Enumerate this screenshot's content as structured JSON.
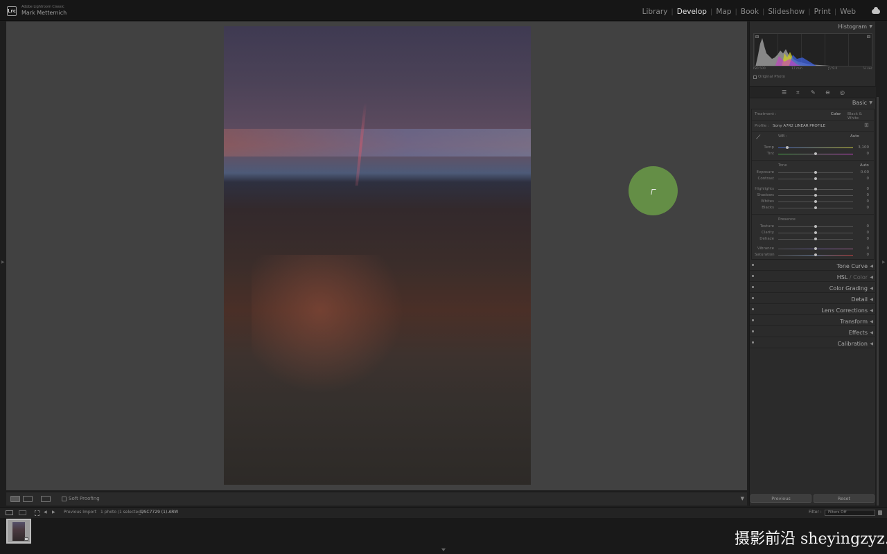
{
  "app": {
    "badge": "Lrc",
    "name": "Adobe Lightroom Classic",
    "user": "Mark Metternich"
  },
  "modules": [
    {
      "label": "Library",
      "active": false
    },
    {
      "label": "Develop",
      "active": true
    },
    {
      "label": "Map",
      "active": false
    },
    {
      "label": "Book",
      "active": false
    },
    {
      "label": "Slideshow",
      "active": false
    },
    {
      "label": "Print",
      "active": false
    },
    {
      "label": "Web",
      "active": false
    }
  ],
  "toolbar": {
    "soft_proofing": "Soft Proofing"
  },
  "histogram": {
    "title": "Histogram",
    "iso": "ISO 500",
    "focal": "17 mm",
    "aperture": "ƒ / 9.0",
    "shutter": "⅓ sec",
    "original_photo": "Original Photo"
  },
  "basic": {
    "title": "Basic",
    "treatment_label": "Treatment :",
    "treatment_color": "Color",
    "treatment_bw": "Black & White",
    "profile_label": "Profile :",
    "profile_value": "Sony A7R2 LINEAR PROFILE",
    "wb_label": "WB :",
    "wb_value": "Auto",
    "tone_label": "Tone",
    "tone_auto": "Auto",
    "presence_label": "Presence",
    "temp": {
      "label": "Temp",
      "value": "3,100",
      "pos": 0.12
    },
    "tint": {
      "label": "Tint",
      "value": "0",
      "pos": 0.5
    },
    "exposure": {
      "label": "Exposure",
      "value": "0.00",
      "pos": 0.5
    },
    "contrast": {
      "label": "Contrast",
      "value": "0",
      "pos": 0.5
    },
    "highlights": {
      "label": "Highlights",
      "value": "0",
      "pos": 0.5
    },
    "shadows": {
      "label": "Shadows",
      "value": "0",
      "pos": 0.5
    },
    "whites": {
      "label": "Whites",
      "value": "0",
      "pos": 0.5
    },
    "blacks": {
      "label": "Blacks",
      "value": "0",
      "pos": 0.5
    },
    "texture": {
      "label": "Texture",
      "value": "0",
      "pos": 0.5
    },
    "clarity": {
      "label": "Clarity",
      "value": "0",
      "pos": 0.5
    },
    "dehaze": {
      "label": "Dehaze",
      "value": "0",
      "pos": 0.5
    },
    "vibrance": {
      "label": "Vibrance",
      "value": "0",
      "pos": 0.5
    },
    "saturation": {
      "label": "Saturation",
      "value": "0",
      "pos": 0.5
    }
  },
  "panels": {
    "tone_curve": "Tone Curve",
    "hsl_a": "HSL",
    "hsl_sep": " / ",
    "hsl_b": "Color",
    "color_grading": "Color Grading",
    "detail": "Detail",
    "lens_corrections": "Lens Corrections",
    "transform": "Transform",
    "effects": "Effects",
    "calibration": "Calibration"
  },
  "buttons": {
    "previous": "Previous",
    "reset": "Reset"
  },
  "filmstrip": {
    "source": "Previous Import",
    "count": "1 photo /1 selected /",
    "filename": "_DSC7729 (1).ARW",
    "filter_label": "Filter :",
    "filter_value": "Filters Off"
  },
  "watermark": "摄影前沿 sheyingzyz.com",
  "colors": {
    "accent_halo": "#70a848",
    "panel_bg": "#2b2b2b",
    "canvas_bg": "#414141"
  }
}
